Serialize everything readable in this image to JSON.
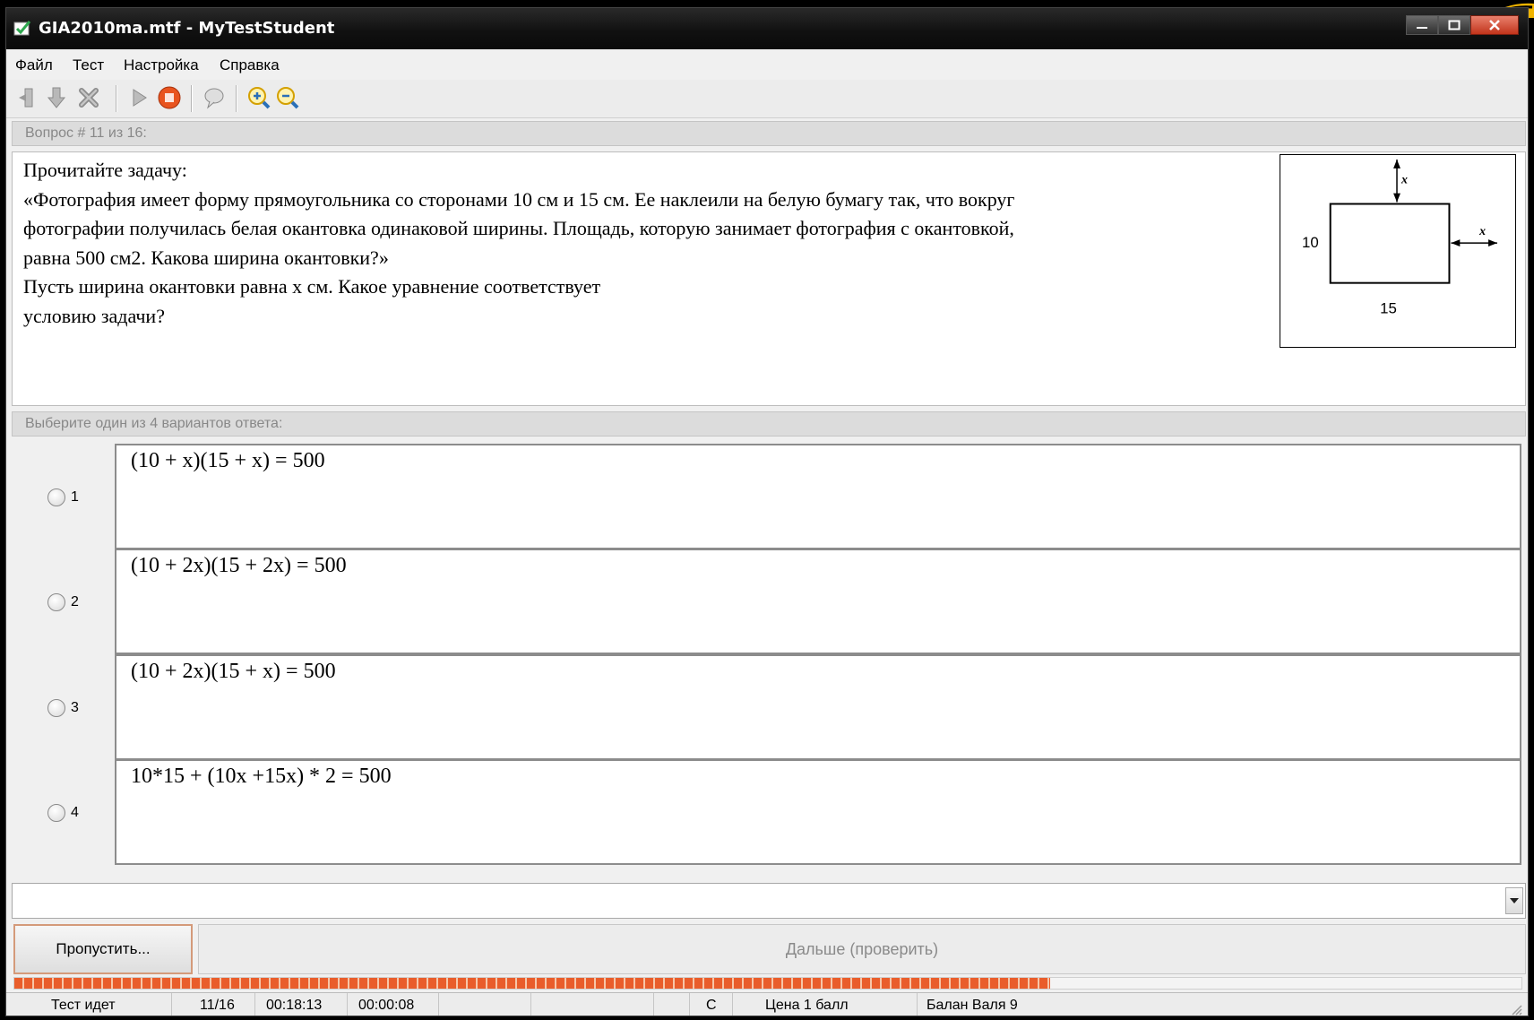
{
  "window": {
    "title": "GIA2010ma.mtf - MyTestStudent"
  },
  "menu": {
    "items": [
      "Файл",
      "Тест",
      "Настройка",
      "Справка"
    ]
  },
  "toolbar": {
    "icons": [
      "login-icon",
      "download-icon",
      "delete-icon",
      "play-icon",
      "stop-icon",
      "chat-icon",
      "zoom-in-icon",
      "zoom-out-icon"
    ]
  },
  "question": {
    "header": "Вопрос # 11 из 16:",
    "lines": [
      "Прочитайте задачу:",
      "«Фотография имеет форму прямоугольника со сторонами 10 см и 15 см. Ее наклеили на белую бумагу так, что вокруг",
      "фотографии получилась белая окантовка одинаковой ширины. Площадь, которую занимает фотография с окантовкой,",
      "равна 500 см2. Какова ширина окантовки?»",
      "Пусть ширина окантовки равна x см. Какое уравнение соответствует",
      "условию задачи?"
    ],
    "figure": {
      "label_x_top": "x",
      "label_x_right": "x",
      "label_height": "10",
      "label_width": "15"
    }
  },
  "answers": {
    "header": "Выберите один из 4 вариантов ответа:",
    "options": [
      {
        "num": "1",
        "text": "(10 + x)(15 + x) = 500"
      },
      {
        "num": "2",
        "text": "(10 + 2x)(15 + 2x) = 500"
      },
      {
        "num": "3",
        "text": "(10 + 2x)(15 + x) = 500"
      },
      {
        "num": "4",
        "text": "10*15 + (10x +15x) * 2 = 500"
      }
    ]
  },
  "combo": {
    "value": ""
  },
  "buttons": {
    "skip": "Пропустить...",
    "next": "Дальше (проверить)"
  },
  "progress": {
    "fraction": 0.6875
  },
  "status": {
    "state": "Тест идет",
    "counter": "11/16",
    "time_total": "00:18:13",
    "time_question": "00:00:08",
    "flag": "C",
    "price": "Цена 1 балл",
    "user": "Балан Валя 9"
  },
  "colors": {
    "titlebar": "#111111",
    "progress": "#e95d2b",
    "skip_border": "#d49a7a"
  }
}
